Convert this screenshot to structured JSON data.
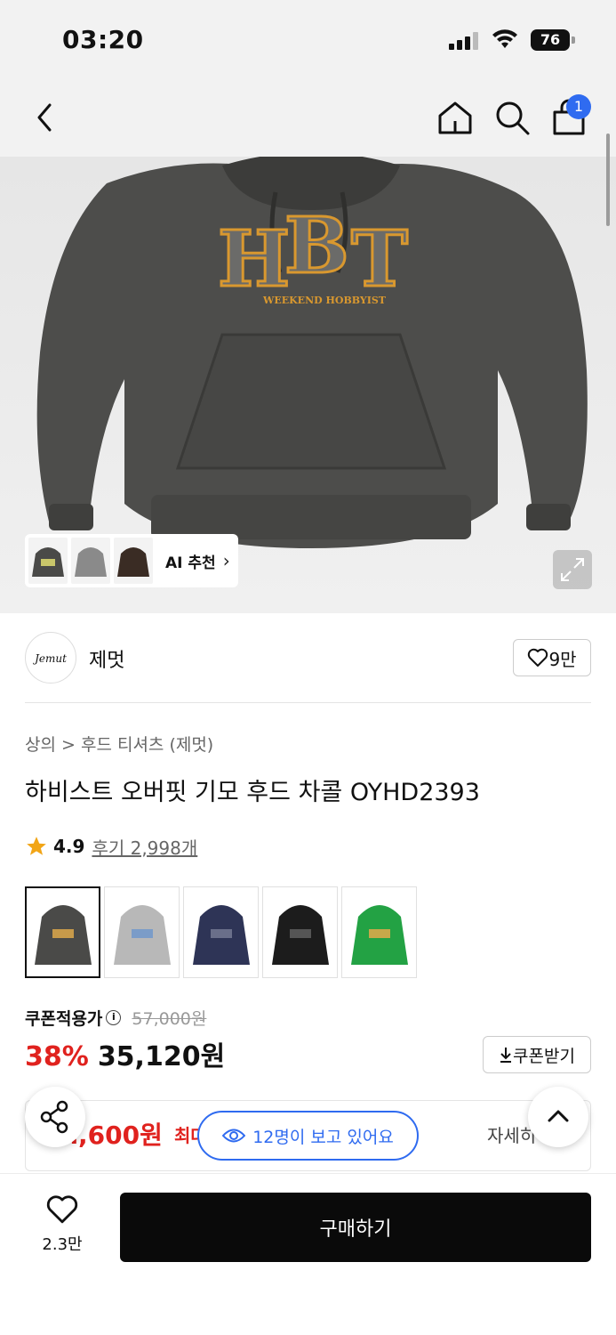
{
  "status_bar": {
    "time": "03:20",
    "battery": "76"
  },
  "header": {
    "cart_count": "1"
  },
  "hero": {
    "ai_label": "AI 추천"
  },
  "brand": {
    "logo_text": "Jemut",
    "name": "제멋",
    "like_count": "9만"
  },
  "product": {
    "breadcrumb": "상의 > 후드 티셔츠 (제멋)",
    "title": "하비스트 오버핏 기모 후드 차콜 OYHD2393",
    "rating": "4.9",
    "reviews": "후기 2,998개",
    "swatch_colors": [
      "#4a4a48",
      "#b8b8b8",
      "#2e3456",
      "#1c1c1c",
      "#23a244"
    ]
  },
  "price": {
    "coupon_label": "쿠폰적용가",
    "original": "57,000원",
    "discount": "38%",
    "final": "35,120원",
    "coupon_button": "쿠폰받기",
    "max_price": "…,600원",
    "max_label": "최대",
    "detail": "자세히"
  },
  "viewers": "12명이 보고 있어요",
  "bottom": {
    "wish_count": "2.3만",
    "buy_label": "구매하기"
  }
}
